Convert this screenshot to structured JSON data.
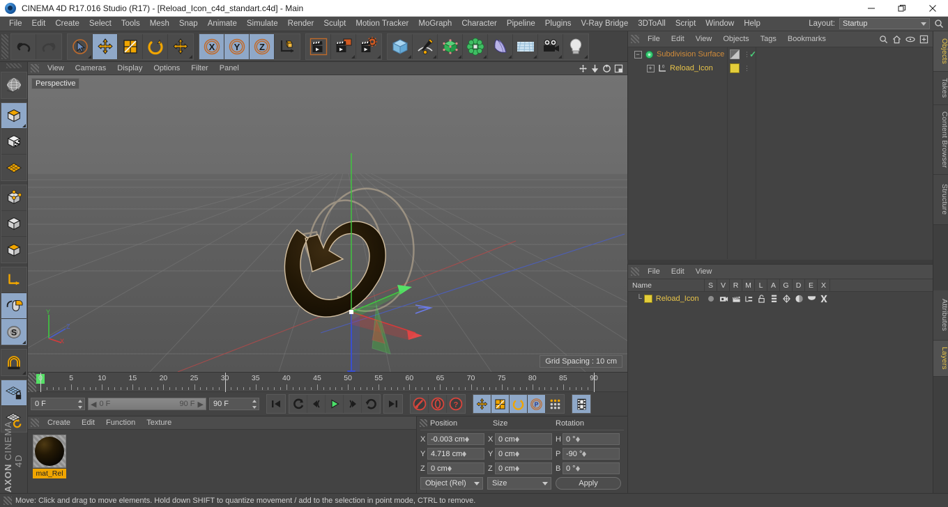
{
  "window": {
    "title": "CINEMA 4D R17.016 Studio (R17) - [Reload_Icon_c4d_standart.c4d] - Main",
    "minimize": "—",
    "maximize": "❐",
    "close": "✕"
  },
  "menubar": {
    "items": [
      "File",
      "Edit",
      "Create",
      "Select",
      "Tools",
      "Mesh",
      "Snap",
      "Animate",
      "Simulate",
      "Render",
      "Sculpt",
      "Motion Tracker",
      "MoGraph",
      "Character",
      "Pipeline",
      "Plugins",
      "V-Ray Bridge",
      "3DToAll",
      "Script",
      "Window",
      "Help"
    ],
    "layout_label": "Layout:",
    "layout_value": "Startup",
    "search_icon": "search-icon"
  },
  "toolbar": {
    "groups": [
      {
        "name": "undo-redo",
        "buttons": [
          {
            "name": "undo",
            "icon": "undo-arrow-icon",
            "state": "normal"
          },
          {
            "name": "redo",
            "icon": "redo-arrow-icon",
            "state": "disabled"
          }
        ]
      },
      {
        "name": "transform-tools",
        "buttons": [
          {
            "name": "live-selection",
            "icon": "cursor-circle-icon",
            "state": "normal"
          },
          {
            "name": "move",
            "icon": "move-arrows-icon",
            "state": "active"
          },
          {
            "name": "scale",
            "icon": "scale-box-icon",
            "state": "normal"
          },
          {
            "name": "rotate",
            "icon": "rotate-circle-icon",
            "state": "normal"
          },
          {
            "name": "move-dynamic",
            "icon": "move-arrows-icon",
            "state": "normal"
          }
        ]
      },
      {
        "name": "axis-locks",
        "buttons": [
          {
            "name": "lock-x",
            "icon": "x-axis-icon",
            "state": "active"
          },
          {
            "name": "lock-y",
            "icon": "y-axis-icon",
            "state": "active"
          },
          {
            "name": "lock-z",
            "icon": "z-axis-icon",
            "state": "active"
          },
          {
            "name": "world-object-coordinates",
            "icon": "axis-cube-icon",
            "state": "normal"
          }
        ]
      },
      {
        "name": "render-group",
        "buttons": [
          {
            "name": "render-view",
            "icon": "clapper-frame-icon",
            "state": "normal"
          },
          {
            "name": "render-region",
            "icon": "clapper-window-icon",
            "state": "normal"
          },
          {
            "name": "render-settings",
            "icon": "clapper-gear-icon",
            "state": "normal"
          }
        ]
      },
      {
        "name": "object-creation",
        "buttons": [
          {
            "name": "add-cube",
            "icon": "blue-cube-icon",
            "state": "normal"
          },
          {
            "name": "add-spline",
            "icon": "pen-spline-icon",
            "state": "normal"
          },
          {
            "name": "add-nurbs",
            "icon": "green-cube-icon",
            "state": "normal"
          },
          {
            "name": "add-array",
            "icon": "green-cluster-icon",
            "state": "normal"
          },
          {
            "name": "add-deformer",
            "icon": "bend-shape-icon",
            "state": "normal"
          },
          {
            "name": "add-environment",
            "icon": "floor-grid-icon",
            "state": "normal"
          },
          {
            "name": "add-camera",
            "icon": "camera-icon",
            "state": "normal"
          },
          {
            "name": "add-light",
            "icon": "lightbulb-icon",
            "state": "normal"
          }
        ]
      }
    ]
  },
  "lefttoolbar": {
    "buttons": [
      {
        "name": "make-editable",
        "icon": "globe-wire-icon",
        "state": "normal"
      },
      {
        "name": "model-mode",
        "icon": "orange-cube-icon",
        "state": "active"
      },
      {
        "name": "texture-mode",
        "icon": "checker-cube-icon",
        "state": "normal"
      },
      {
        "name": "workplane-mode",
        "icon": "orange-grid-icon",
        "state": "normal"
      },
      {
        "name": "point-mode",
        "icon": "points-cube-icon",
        "state": "normal"
      },
      {
        "name": "edge-mode",
        "icon": "edges-cube-icon",
        "state": "normal"
      },
      {
        "name": "polygon-mode",
        "icon": "polygon-cube-icon",
        "state": "normal"
      },
      {
        "name": "axis-modification",
        "icon": "axis-l-icon",
        "state": "normal"
      },
      {
        "name": "enable-axis",
        "icon": "mouse-axis-icon",
        "state": "active"
      },
      {
        "name": "soft-selection",
        "icon": "s-circle-icon",
        "state": "active"
      },
      {
        "name": "snap-magnet",
        "icon": "magnet-icon",
        "state": "normal"
      },
      {
        "name": "workplane-lock",
        "icon": "grid-lock-icon",
        "state": "active"
      },
      {
        "name": "workplane-reset",
        "icon": "grid-reset-icon",
        "state": "normal"
      }
    ],
    "brand_bold": "MAXON",
    "brand_rest": "CINEMA 4D"
  },
  "viewport": {
    "menus": [
      "View",
      "Cameras",
      "Display",
      "Options",
      "Filter",
      "Panel"
    ],
    "corner_icons": [
      "pan-icon",
      "dolly-icon",
      "rotate-icon",
      "maximize-view-icon"
    ],
    "camera_label": "Perspective",
    "grid_spacing": "Grid Spacing : 10 cm",
    "axis_gizmo": {
      "x": "X",
      "y": "Y",
      "z": "Z"
    }
  },
  "timeline": {
    "ticks": [
      {
        "label": "0",
        "frame": 0
      },
      {
        "label": "5",
        "frame": 5
      },
      {
        "label": "10",
        "frame": 10
      },
      {
        "label": "15",
        "frame": 15
      },
      {
        "label": "20",
        "frame": 20
      },
      {
        "label": "25",
        "frame": 25
      },
      {
        "label": "30",
        "frame": 30
      },
      {
        "label": "35",
        "frame": 35
      },
      {
        "label": "40",
        "frame": 40
      },
      {
        "label": "45",
        "frame": 45
      },
      {
        "label": "50",
        "frame": 50
      },
      {
        "label": "55",
        "frame": 55
      },
      {
        "label": "60",
        "frame": 60
      },
      {
        "label": "65",
        "frame": 65
      },
      {
        "label": "70",
        "frame": 70
      },
      {
        "label": "75",
        "frame": 75
      },
      {
        "label": "80",
        "frame": 80
      },
      {
        "label": "85",
        "frame": 85
      },
      {
        "label": "90",
        "frame": 90
      }
    ],
    "current_frame_field": "0 F",
    "start_frame": "0 F",
    "range_start": "0 F",
    "range_end": "90 F",
    "end_frame": "90 F",
    "transport": [
      {
        "name": "go-to-start",
        "icon": "skip-start-icon"
      },
      {
        "name": "play-backwards-loop",
        "icon": "loop-back-icon"
      },
      {
        "name": "step-back",
        "icon": "step-back-icon"
      },
      {
        "name": "play-forward",
        "icon": "play-icon"
      },
      {
        "name": "step-forward",
        "icon": "step-forward-icon"
      },
      {
        "name": "loop-playback",
        "icon": "loop-icon"
      },
      {
        "name": "go-to-end",
        "icon": "skip-end-icon"
      }
    ],
    "keyframe_tools": [
      {
        "name": "record-active-objects",
        "icon": "record-key-icon"
      },
      {
        "name": "autokeying",
        "icon": "autokey-icon"
      },
      {
        "name": "keyframe-selection",
        "icon": "question-key-icon"
      }
    ],
    "key_channels": [
      {
        "name": "position-key",
        "icon": "move-arrows-icon",
        "state": "active"
      },
      {
        "name": "scale-key",
        "icon": "scale-box-icon",
        "state": "active"
      },
      {
        "name": "rotation-key",
        "icon": "rotate-circle-icon",
        "state": "active"
      },
      {
        "name": "parameter-key",
        "icon": "p-circle-icon",
        "state": "active"
      },
      {
        "name": "point-level-animation",
        "icon": "pla-dots-icon",
        "state": "normal"
      }
    ],
    "filmstrip": {
      "name": "animation-layers",
      "icon": "filmstrip-icon",
      "state": "active"
    }
  },
  "material_manager": {
    "menus": [
      "Create",
      "Edit",
      "Function",
      "Texture"
    ],
    "materials": [
      {
        "name": "mat_Rel",
        "selected": true
      }
    ]
  },
  "coordinates": {
    "headers": [
      "Position",
      "Size",
      "Rotation"
    ],
    "rows": [
      {
        "pos_axis": "X",
        "pos_value": "-0.003 cm",
        "size_axis": "X",
        "size_value": "0 cm",
        "rot_axis": "H",
        "rot_value": "0 °"
      },
      {
        "pos_axis": "Y",
        "pos_value": "4.718 cm",
        "size_axis": "Y",
        "size_value": "0 cm",
        "rot_axis": "P",
        "rot_value": "-90 °"
      },
      {
        "pos_axis": "Z",
        "pos_value": "0 cm",
        "size_axis": "Z",
        "size_value": "0 cm",
        "rot_axis": "B",
        "rot_value": "0 °"
      }
    ],
    "coord_system": "Object (Rel)",
    "size_mode": "Size",
    "apply_label": "Apply"
  },
  "object_manager": {
    "menus": [
      "File",
      "Edit",
      "View",
      "Objects",
      "Tags",
      "Bookmarks"
    ],
    "right_icons": [
      "search-icon",
      "home-icon",
      "eye-icon",
      "new-layer-icon"
    ],
    "items": [
      {
        "name": "Subdivision Surface",
        "icon": "subdivision-surface-icon",
        "color": "#d08b3a",
        "depth": 0,
        "tags": [
          {
            "name": "display-tag",
            "icon": "half-shade-icon"
          }
        ],
        "check": true
      },
      {
        "name": "Reload_Icon",
        "icon": "extrude-icon",
        "color": "#e8c44a",
        "depth": 1,
        "tags": [
          {
            "name": "material-tag",
            "icon": "yellow-swatch-icon"
          }
        ],
        "check": false
      }
    ]
  },
  "attribute_manager": {
    "menus": [
      "File",
      "Edit",
      "View"
    ],
    "columns": [
      "Name",
      "S",
      "V",
      "R",
      "M",
      "L",
      "A",
      "G",
      "D",
      "E",
      "X"
    ],
    "rows": [
      {
        "name": "Reload_Icon",
        "swatch": "#e8c44a",
        "icons": [
          "dot-icon",
          "camera-render-icon",
          "clapper-icon",
          "hierarchy-icon",
          "lock-open-icon",
          "layers-strip-icon",
          "deform-icon",
          "shade-icon",
          "cap-icon",
          "x-dynamic-icon"
        ]
      }
    ]
  },
  "tabstrip": {
    "tabs": [
      {
        "label": "Objects",
        "active": true
      },
      {
        "label": "Takes",
        "active": false
      },
      {
        "label": "Content Browser",
        "active": false
      },
      {
        "label": "Structure",
        "active": false
      },
      {
        "label": "Attributes",
        "active": false
      },
      {
        "label": "Layers",
        "active": true
      }
    ]
  },
  "statusbar": {
    "message": "Move: Click and drag to move elements. Hold down SHIFT to quantize movement / add to the selection in point mode, CTRL to remove."
  },
  "colors": {
    "accent_orange": "#f0a500",
    "selection_blue": "#8fa8c8",
    "axis_x": "#d83a3a",
    "axis_y": "#3fc83f",
    "axis_z": "#4a6ee0",
    "panel_bg": "#434343"
  }
}
